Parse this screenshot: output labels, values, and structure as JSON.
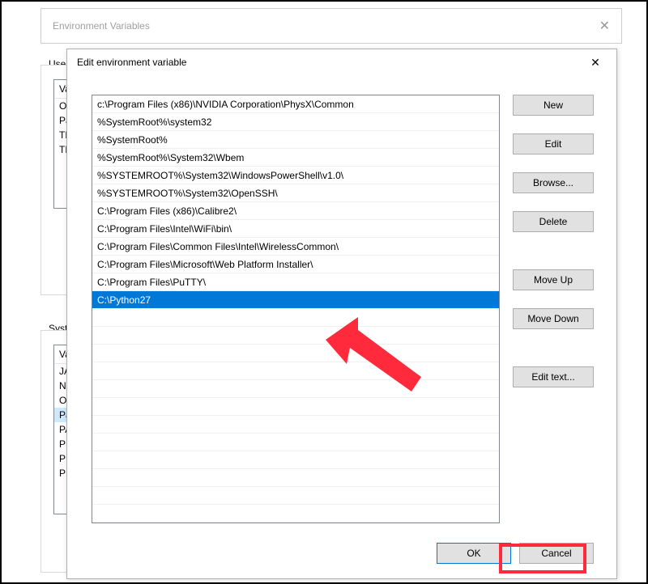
{
  "bg": {
    "title": "Environment Variables",
    "user_label": "User",
    "system_label": "Syste",
    "list1_prefixes": [
      "Va",
      "O",
      "Pa",
      "TE",
      "TM"
    ],
    "list2_prefixes": [
      "Va",
      "JA",
      "NU",
      "OS",
      "Pa",
      "PA",
      "PR",
      "PR",
      "PR"
    ]
  },
  "modal": {
    "title": "Edit environment variable",
    "paths": [
      "c:\\Program Files (x86)\\NVIDIA Corporation\\PhysX\\Common",
      "%SystemRoot%\\system32",
      "%SystemRoot%",
      "%SystemRoot%\\System32\\Wbem",
      "%SYSTEMROOT%\\System32\\WindowsPowerShell\\v1.0\\",
      "%SYSTEMROOT%\\System32\\OpenSSH\\",
      "C:\\Program Files (x86)\\Calibre2\\",
      "C:\\Program Files\\Intel\\WiFi\\bin\\",
      "C:\\Program Files\\Common Files\\Intel\\WirelessCommon\\",
      "C:\\Program Files\\Microsoft\\Web Platform Installer\\",
      "C:\\Program Files\\PuTTY\\",
      "C:\\Python27"
    ],
    "selected_index": 11,
    "buttons": {
      "new": "New",
      "edit": "Edit",
      "browse": "Browse...",
      "delete": "Delete",
      "move_up": "Move Up",
      "move_down": "Move Down",
      "edit_text": "Edit text...",
      "ok": "OK",
      "cancel": "Cancel"
    }
  }
}
